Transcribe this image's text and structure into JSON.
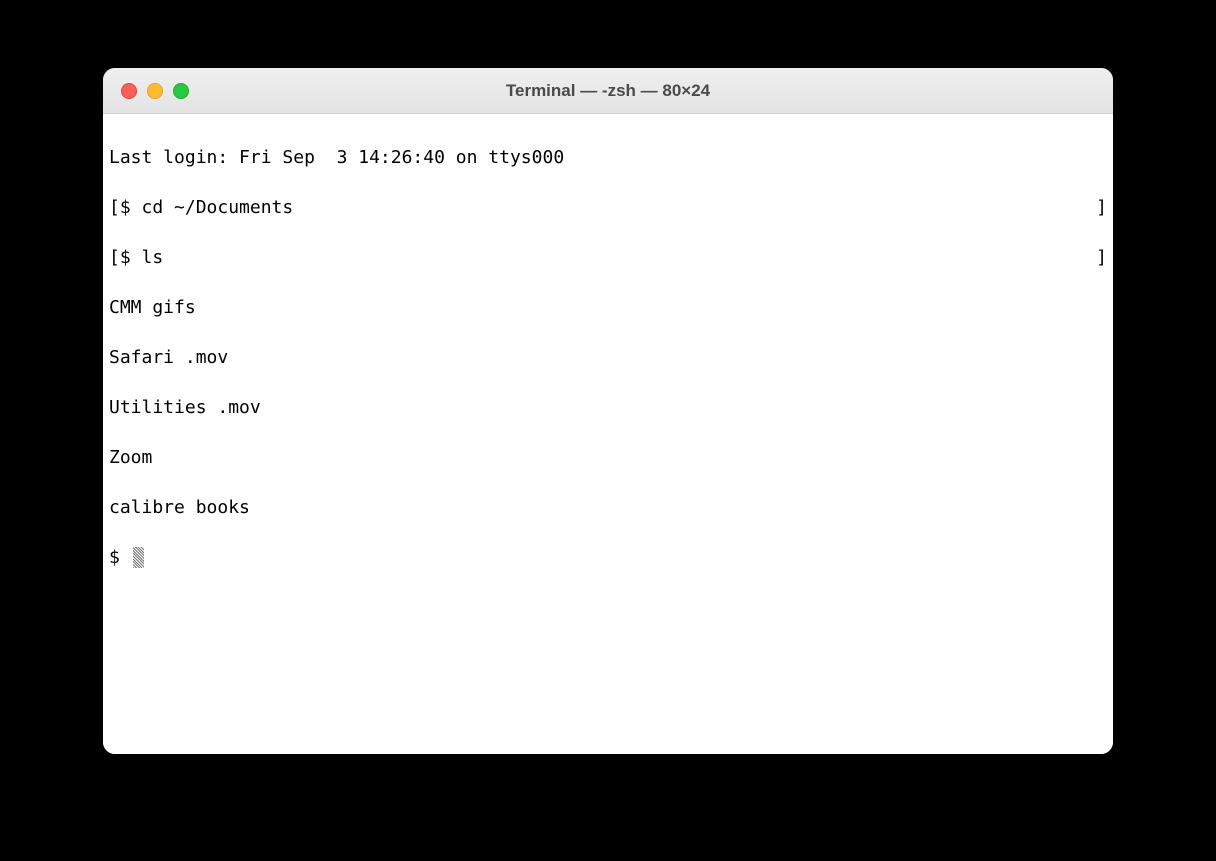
{
  "window": {
    "title": "Terminal — -zsh — 80×24"
  },
  "terminal": {
    "lines": [
      {
        "left": "Last login: Fri Sep  3 14:26:40 on ttys000",
        "right": ""
      },
      {
        "left": "[$ cd ~/Documents",
        "right": "]"
      },
      {
        "left": "[$ ls",
        "right": "]"
      },
      {
        "left": "CMM gifs",
        "right": ""
      },
      {
        "left": "Safari .mov",
        "right": ""
      },
      {
        "left": "Utilities .mov",
        "right": ""
      },
      {
        "left": "Zoom",
        "right": ""
      },
      {
        "left": "calibre books",
        "right": ""
      }
    ],
    "prompt": "$ "
  }
}
